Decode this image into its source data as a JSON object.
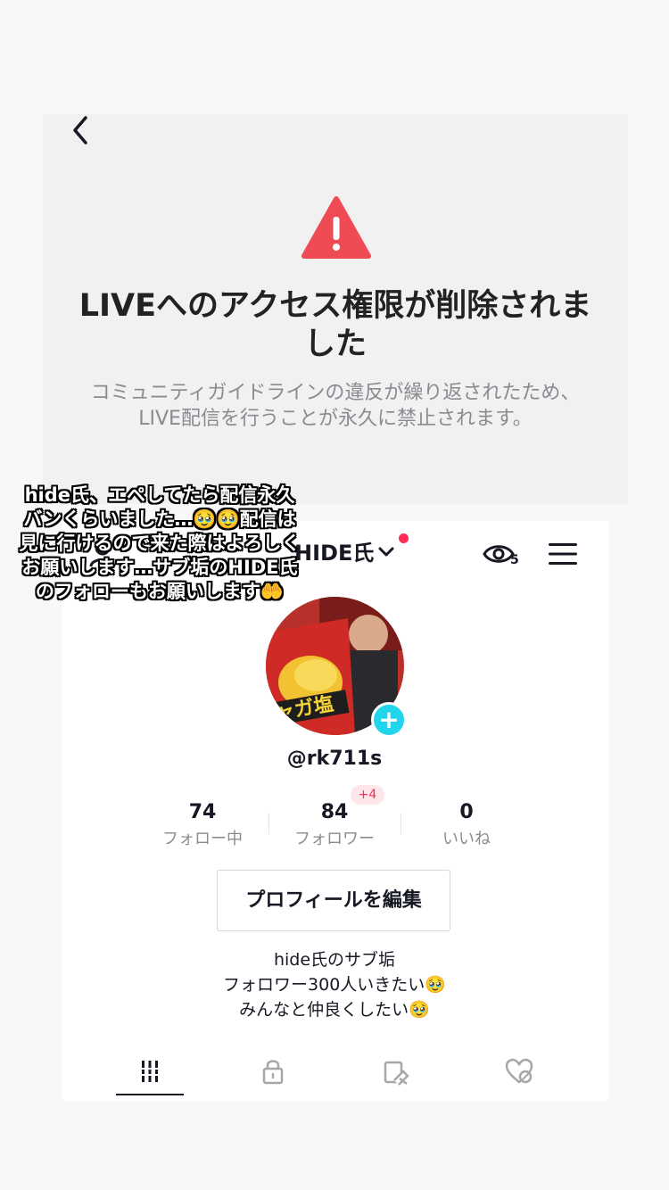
{
  "notice": {
    "title": "LIVEへのアクセス権限が削除されました",
    "body": "コミュニティガイドラインの違反が繰り返されたため、LIVE配信を行うことが永久に禁止されます。",
    "warning_color": "#ee4b55"
  },
  "header": {
    "username": "HIDE氏",
    "viewer_count": "5",
    "icons": [
      "add-friend-icon",
      "chevron-down-icon",
      "eye-icon",
      "menu-icon"
    ]
  },
  "profile": {
    "handle": "@rk711s",
    "avatar_text": "ャガ塩",
    "accent_color": "#20d5ec"
  },
  "stats": [
    {
      "value": "74",
      "label": "フォロー中"
    },
    {
      "value": "84",
      "label": "フォロワー",
      "badge": "+4"
    },
    {
      "value": "0",
      "label": "いいね"
    }
  ],
  "edit_button": "プロフィールを編集",
  "bio": {
    "line1": "hide氏のサブ垢",
    "line2": "フォロワー300人いきたい🥹",
    "line3": "みんなと仲良くしたい🥹"
  },
  "tabs": [
    "grid-icon",
    "lock-icon",
    "tagged-icon",
    "liked-icon"
  ],
  "caption": "hide氏、エペしてたら配信永久バンくらいました…🥹🥹配信は見に行けるので来た際はよろしくお願いします…サブ垢のHIDE氏のフォローもお願いします🤲"
}
